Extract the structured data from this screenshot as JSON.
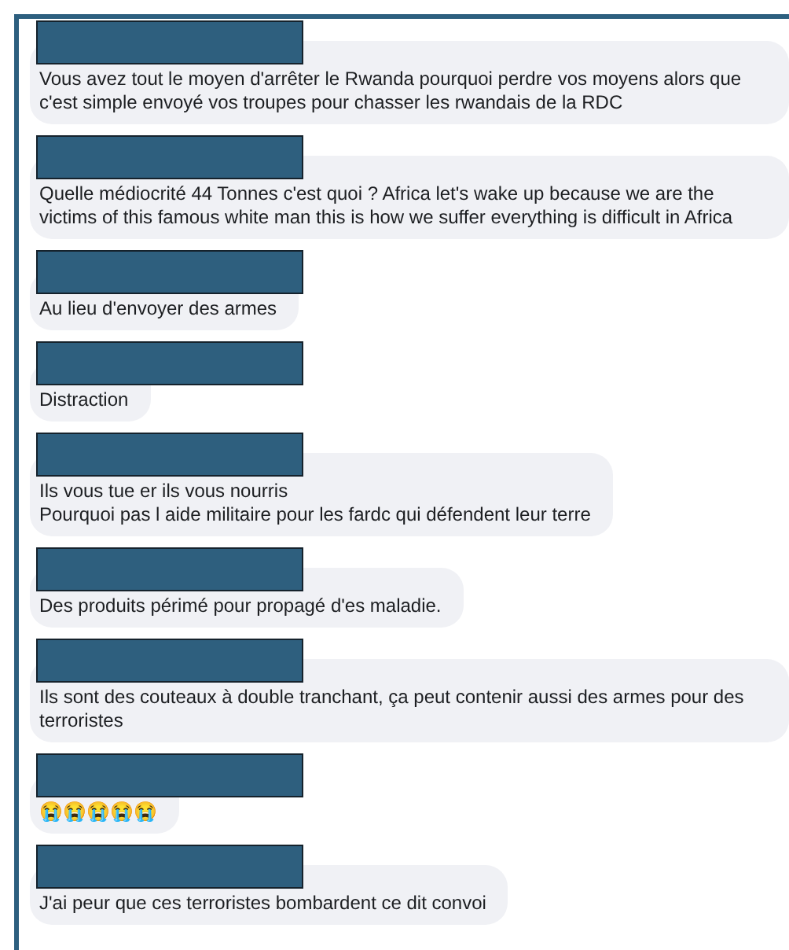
{
  "comments": [
    {
      "name_redacted": true,
      "text": "Vous avez tout le moyen d'arrêter le Rwanda pourquoi perdre vos moyens alors que c'est simple envoyé vos troupes pour chasser les rwandais de la RDC"
    },
    {
      "name_redacted": true,
      "text": "Quelle médiocrité 44 Tonnes c'est quoi ? Africa let's wake up because we are the victims of this famous white man this is how we suffer everything is difficult in Africa"
    },
    {
      "name_redacted": true,
      "text": "Au lieu d'envoyer des armes"
    },
    {
      "name_redacted": true,
      "text": "Distraction"
    },
    {
      "name_redacted": true,
      "text": "Ils vous tue er ils vous nourris\nPourquoi pas l aide militaire pour les fardc qui défendent leur terre"
    },
    {
      "name_redacted": true,
      "text": "Des produits périmé pour propagé d'es maladie."
    },
    {
      "name_redacted": true,
      "text": "Ils sont des couteaux à double tranchant, ça peut contenir aussi des armes pour des terroristes"
    },
    {
      "name_redacted": true,
      "text": "😭😭😭😭😭"
    },
    {
      "name_redacted": true,
      "text": "J'ai peur que ces terroristes bombardent ce dit convoi"
    }
  ]
}
